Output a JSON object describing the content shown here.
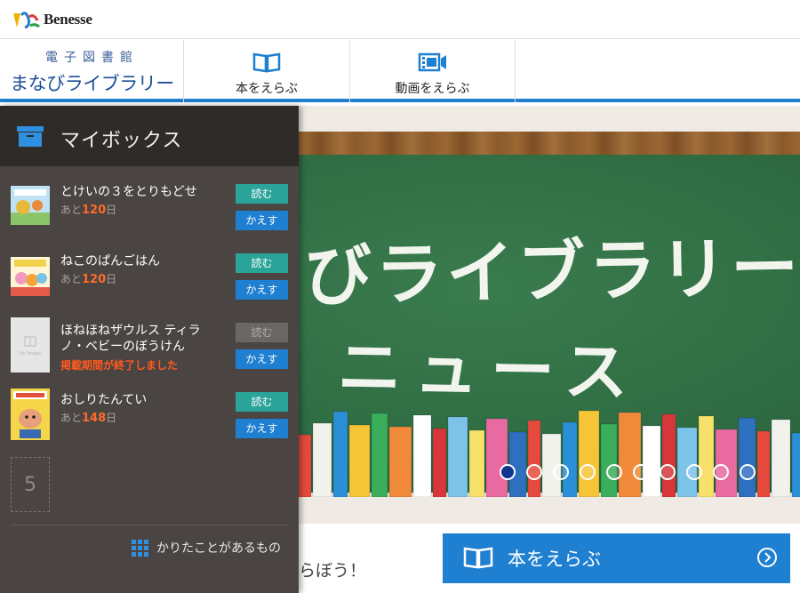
{
  "brand": {
    "name": "Benesse",
    "accent": "#1f7fd0"
  },
  "site": {
    "subtitle": "電子図書館",
    "title": "まなびライブラリー"
  },
  "nav": {
    "books_label": "本をえらぶ",
    "videos_label": "動画をえらぶ",
    "books_icon": "book-icon",
    "videos_icon": "film-icon"
  },
  "banner": {
    "line1": "びライブラリー",
    "line2": "ニュース",
    "slides_total": 10,
    "active_slide": 1
  },
  "bottom": {
    "partial_text": "らぼう！",
    "select_books_label": "本をえらぶ"
  },
  "mybox": {
    "title": "マイボックス",
    "read_label": "読む",
    "return_label": "かえす",
    "items": [
      {
        "title": "とけいの３をとりもどせ",
        "status_prefix": "あと",
        "days": "120",
        "status_suffix": "日",
        "read_enabled": true
      },
      {
        "title": "ねこのぱんごはん",
        "status_prefix": "あと",
        "days": "120",
        "status_suffix": "日",
        "read_enabled": true
      },
      {
        "title": "ほねほねザウルス ティラノ・ベビーのぼうけん",
        "ended_text": "掲載期間が終了しました",
        "no_image_label": "No Image",
        "read_enabled": false
      },
      {
        "title": "おしりたんてい",
        "status_prefix": "あと",
        "days": "148",
        "status_suffix": "日",
        "read_enabled": true
      }
    ],
    "empty_slot_number": "5",
    "history_label": "かりたことがあるもの"
  }
}
